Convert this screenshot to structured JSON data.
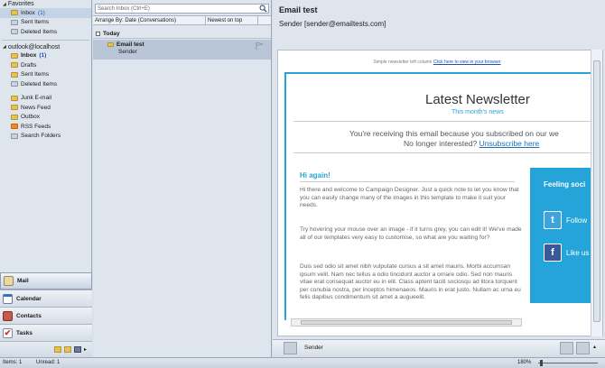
{
  "nav": {
    "favorites_label": "Favorites",
    "favorites": [
      {
        "label": "Inbox",
        "count": "(1)"
      },
      {
        "label": "Sent Items",
        "count": ""
      },
      {
        "label": "Deleted Items",
        "count": ""
      }
    ],
    "account_label": "outlook@localhost",
    "folders": [
      {
        "label": "Inbox",
        "count": "(1)"
      },
      {
        "label": "Drafts",
        "count": ""
      },
      {
        "label": "Sent Items",
        "count": ""
      },
      {
        "label": "Deleted Items",
        "count": ""
      },
      {
        "label": "Junk E-mail",
        "count": ""
      },
      {
        "label": "News Feed",
        "count": ""
      },
      {
        "label": "Outbox",
        "count": ""
      },
      {
        "label": "RSS Feeds",
        "count": ""
      },
      {
        "label": "Search Folders",
        "count": ""
      }
    ],
    "buttons": [
      "Mail",
      "Calendar",
      "Contacts",
      "Tasks"
    ]
  },
  "list": {
    "search_placeholder": "Search Inbox (Ctrl+E)",
    "arrange_label": "Arrange By: Date (Conversations)",
    "sort_label": "Newest on top",
    "group_label": "Today",
    "message": {
      "subject": "Email test",
      "from": "Sender"
    }
  },
  "reading": {
    "subject": "Email test",
    "sender": "Sender [sender@emailtests.com]",
    "newsletter": {
      "top_text": "Simple newsletter left column",
      "top_link": "Click here to view in your browser",
      "title": "Latest Newsletter",
      "subtitle": "This month's news",
      "receiving": "You're receiving this email because you subscribed on our we",
      "no_longer": "No longer interested?",
      "unsubscribe": "Unsubscribe here",
      "greeting": "Hi again!",
      "para1": "Hi there and welcome to Campaign Designer. Just a quick note to let you know that you can easily change many of the images in this template to make it suit your needs.",
      "para2": "Try hovering your mouse over an image - if it turns grey, you can edit it! We've made all of our templates very easy to customise, so what are you waiting for?",
      "para3": "Duis sed odio sit amet nibh vulputate cursus a sit amet mauris. Morbi accumsan ipsum velit. Nam nec tellus a odio tincidunt auctor a ornare odio. Sed non mauris vitae erat consequat auctor eu in elit. Class aptent taciti sociosqu ad litora torquent per conubia nostra, per inceptos himenaeos. Mauris in erat justo. Nullam ac urna eu felis dapibus condimentum sit amet a augueelit.",
      "social_title": "Feeling soci",
      "twitter": "Follow",
      "facebook": "Like us"
    },
    "people_name": "Sender"
  },
  "status": {
    "items": "Items: 1",
    "unread": "Unread: 1",
    "zoom": "180%"
  },
  "colors": {
    "accent": "#24a4d8",
    "selection": "#b8c6d8"
  }
}
